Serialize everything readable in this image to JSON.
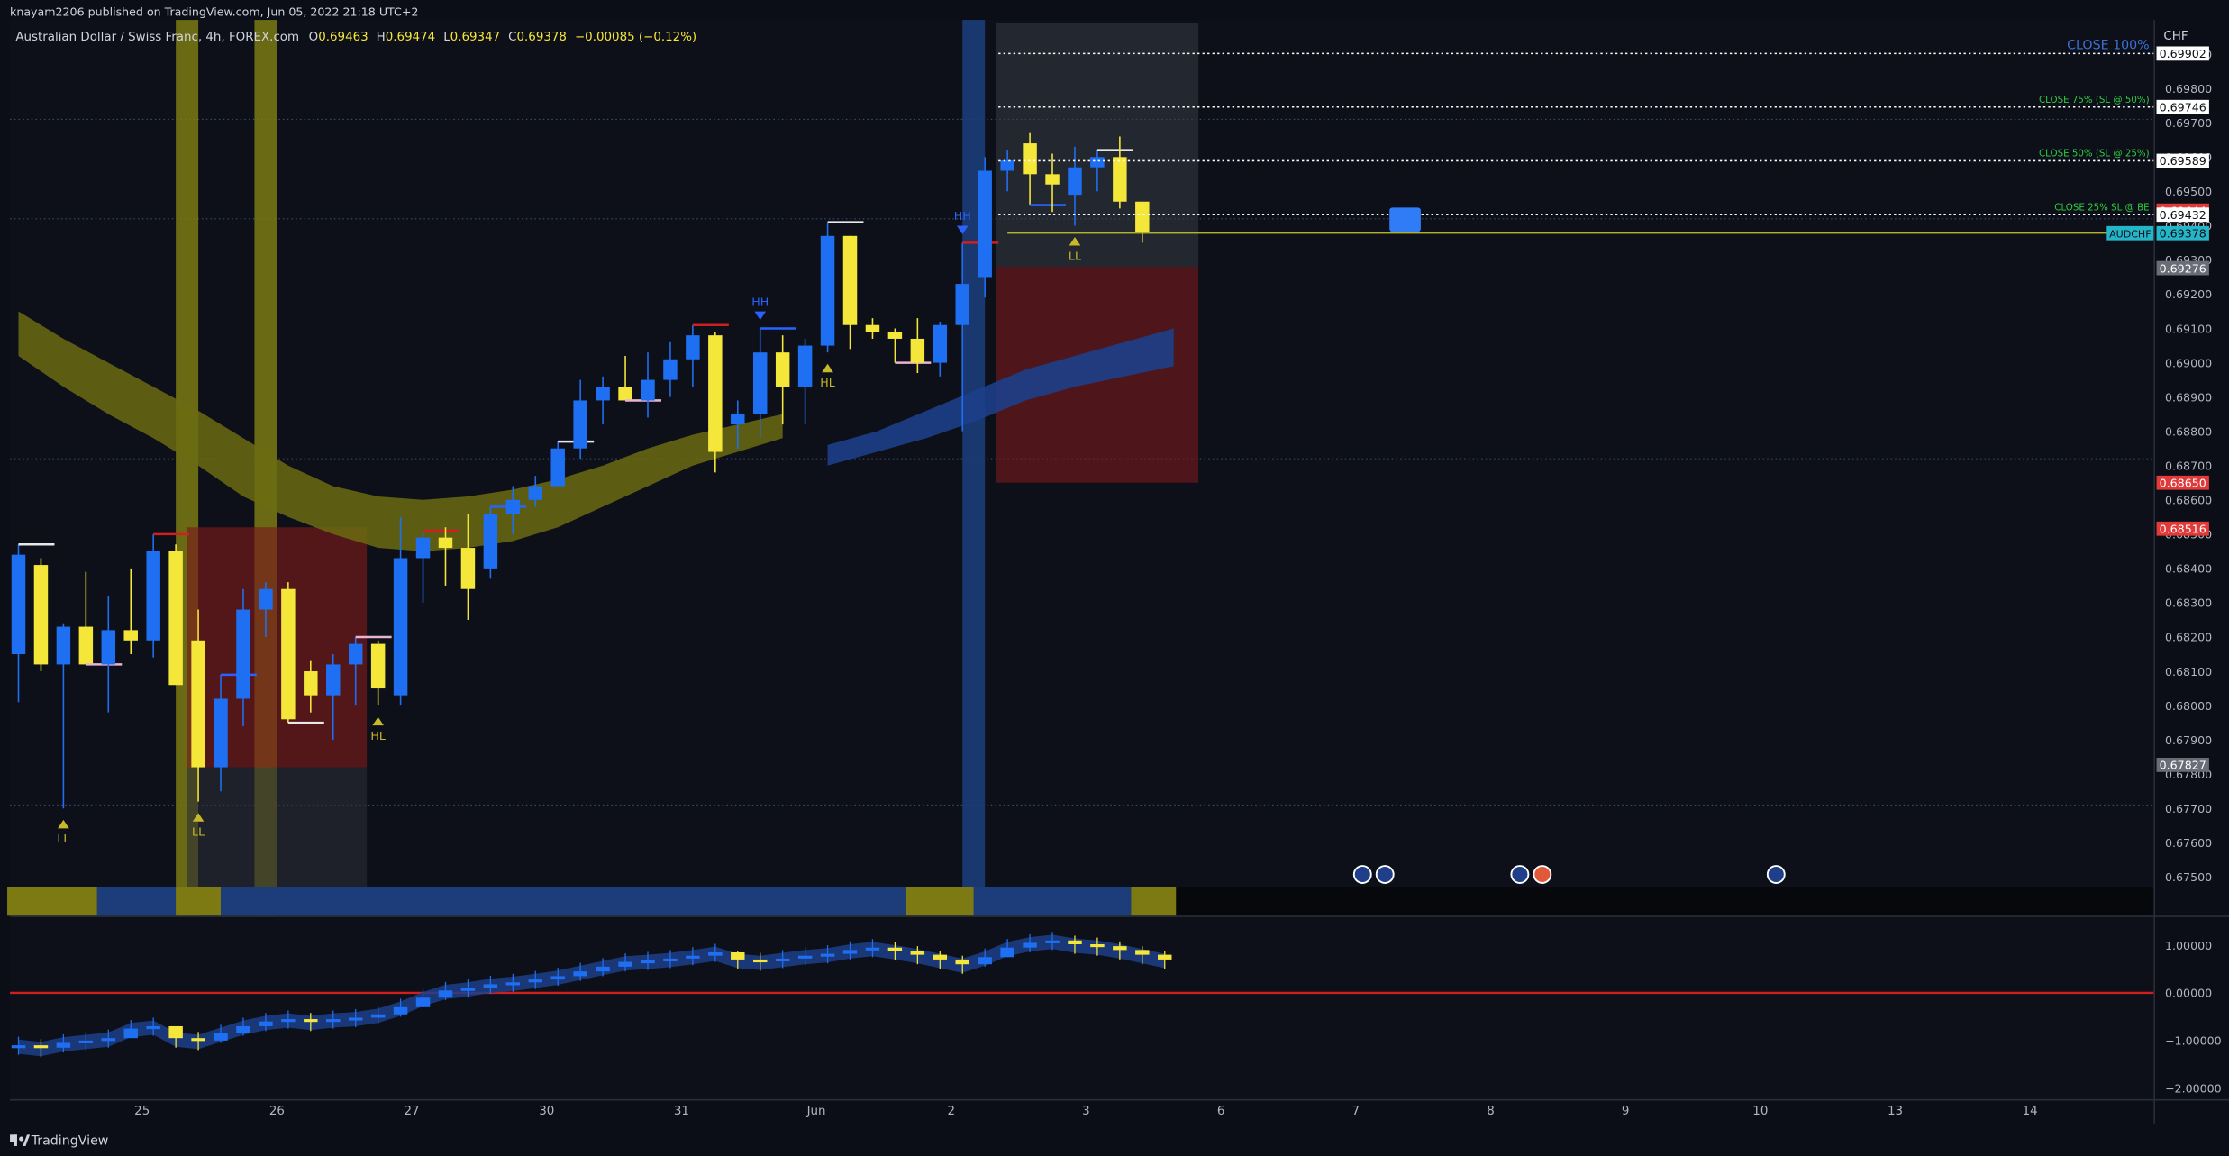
{
  "publisher": {
    "text": "knayam2206 published on TradingView.com, Jun 05, 2022 21:18 UTC+2"
  },
  "legend": {
    "symbol": "Australian Dollar / Swiss Franc, 4h, FOREX.com",
    "o_label": "O",
    "o": "0.69463",
    "h_label": "H",
    "h": "0.69474",
    "l_label": "L",
    "l": "0.69347",
    "c_label": "C",
    "c": "0.69378",
    "change": "−0.00085 (−0.12%)"
  },
  "currency": "CHF",
  "brand": "TradingView",
  "colors": {
    "bull": "#1f6ff2",
    "bear": "#f5e63a",
    "ema_band": "#6b6b12",
    "blue_band": "#1d3f8a",
    "highlight_yellow": "#7d7a14",
    "highlight_blue": "#1c3d7a",
    "red_zone": "#7a1a1a",
    "green_text": "#2ecc40",
    "price_tag_cyan": "#24b6c8",
    "price_tag_red": "#e03a3a",
    "zero_line": "#d01f1f"
  },
  "icons": {
    "brand": "tradingview-logo-icon",
    "events": "economic-event-flag-icon",
    "pivots_up": "triangle-up-icon",
    "pivots_down": "triangle-down-icon"
  },
  "trade_levels": [
    {
      "label": "CLOSE 100%",
      "value": 0.69902,
      "style": "blue"
    },
    {
      "label": "CLOSE 75% (SL @ 50%)",
      "value": 0.69746,
      "style": "green"
    },
    {
      "label": "CLOSE 50% (SL @ 25%)",
      "value": 0.69589,
      "style": "green"
    },
    {
      "label": "CLOSE 25% SL @ BE",
      "value": 0.69432,
      "style": "green"
    }
  ],
  "current_tag": {
    "symbol": "AUDCHF",
    "value": "0.69378"
  },
  "price_tags": [
    {
      "text": "0.69902",
      "value": 0.69902,
      "kind": "white"
    },
    {
      "text": "0.69746",
      "value": 0.69746,
      "kind": "white"
    },
    {
      "text": "0.69589",
      "value": 0.69589,
      "kind": "white"
    },
    {
      "text": "0.69444",
      "value": 0.69444,
      "kind": "red"
    },
    {
      "text": "0.69432",
      "value": 0.69432,
      "kind": "white"
    },
    {
      "text": "0.69378",
      "value": 0.69378,
      "kind": "cyan"
    },
    {
      "text": "0.69276",
      "value": 0.69276,
      "kind": "gray"
    },
    {
      "text": "0.68650",
      "value": 0.6865,
      "kind": "red"
    },
    {
      "text": "0.68516",
      "value": 0.68516,
      "kind": "red"
    },
    {
      "text": "0.67827",
      "value": 0.67827,
      "kind": "gray"
    }
  ],
  "pivot_labels": [
    {
      "text": "LL",
      "dir": "up",
      "x": 2
    },
    {
      "text": "LL",
      "dir": "up",
      "x": 8
    },
    {
      "text": "HL",
      "dir": "up",
      "x": 16
    },
    {
      "text": "HH",
      "dir": "down",
      "x": 33
    },
    {
      "text": "HL",
      "dir": "up",
      "x": 36
    },
    {
      "text": "HH",
      "dir": "down",
      "x": 42
    },
    {
      "text": "LL",
      "dir": "up",
      "x": 47
    }
  ],
  "chart_data": {
    "type": "candlestick",
    "y_axis_ticks": [
      "0.69900",
      "0.69800",
      "0.69700",
      "0.69600",
      "0.69500",
      "0.69400",
      "0.69300",
      "0.69200",
      "0.69100",
      "0.69000",
      "0.68900",
      "0.68800",
      "0.68700",
      "0.68600",
      "0.68500",
      "0.68400",
      "0.68300",
      "0.68200",
      "0.68100",
      "0.68000",
      "0.67900",
      "0.67800",
      "0.67700",
      "0.67600",
      "0.67500"
    ],
    "ylim": [
      0.6747,
      0.7
    ],
    "x_ticks": [
      {
        "label": "25",
        "x": 5.5
      },
      {
        "label": "26",
        "x": 11.5
      },
      {
        "label": "27",
        "x": 17.5
      },
      {
        "label": "30",
        "x": 23.5
      },
      {
        "label": "31",
        "x": 29.5
      },
      {
        "label": "Jun",
        "x": 35.5
      },
      {
        "label": "2",
        "x": 41.5
      },
      {
        "label": "3",
        "x": 47.5
      },
      {
        "label": "6",
        "x": 53.5
      },
      {
        "label": "7",
        "x": 59.5
      },
      {
        "label": "8",
        "x": 65.5
      },
      {
        "label": "9",
        "x": 71.5
      },
      {
        "label": "10",
        "x": 77.5
      },
      {
        "label": "13",
        "x": 83.5
      },
      {
        "label": "14",
        "x": 89.5
      }
    ],
    "x_range": [
      0,
      95
    ],
    "candles": [
      [
        0.6815,
        0.6847,
        0.6801,
        0.6844
      ],
      [
        0.6841,
        0.6843,
        0.681,
        0.6812
      ],
      [
        0.6812,
        0.6824,
        0.677,
        0.6823
      ],
      [
        0.6823,
        0.6839,
        0.6812,
        0.6812
      ],
      [
        0.6812,
        0.6832,
        0.6798,
        0.6822
      ],
      [
        0.6822,
        0.684,
        0.6815,
        0.6819
      ],
      [
        0.6819,
        0.685,
        0.6814,
        0.6845
      ],
      [
        0.6845,
        0.6847,
        0.681,
        0.6806
      ],
      [
        0.6819,
        0.6828,
        0.6772,
        0.6782
      ],
      [
        0.6782,
        0.6809,
        0.6775,
        0.6802
      ],
      [
        0.6802,
        0.6834,
        0.6794,
        0.6828
      ],
      [
        0.6828,
        0.6836,
        0.682,
        0.6834
      ],
      [
        0.6834,
        0.6836,
        0.6795,
        0.6796
      ],
      [
        0.681,
        0.6813,
        0.6798,
        0.6803
      ],
      [
        0.6803,
        0.6815,
        0.679,
        0.6812
      ],
      [
        0.6812,
        0.682,
        0.68,
        0.6818
      ],
      [
        0.6818,
        0.6819,
        0.68,
        0.6805
      ],
      [
        0.6803,
        0.6855,
        0.68,
        0.6843
      ],
      [
        0.6843,
        0.6851,
        0.683,
        0.6849
      ],
      [
        0.6849,
        0.6852,
        0.6835,
        0.6846
      ],
      [
        0.6846,
        0.6856,
        0.6825,
        0.6834
      ],
      [
        0.684,
        0.6858,
        0.6837,
        0.6856
      ],
      [
        0.6856,
        0.6864,
        0.685,
        0.686
      ],
      [
        0.686,
        0.6867,
        0.6858,
        0.6864
      ],
      [
        0.6864,
        0.6877,
        0.6864,
        0.6875
      ],
      [
        0.6875,
        0.6895,
        0.6872,
        0.6889
      ],
      [
        0.6889,
        0.6896,
        0.6882,
        0.6893
      ],
      [
        0.6893,
        0.6902,
        0.6889,
        0.6889
      ],
      [
        0.6889,
        0.6903,
        0.6884,
        0.6895
      ],
      [
        0.6895,
        0.6906,
        0.689,
        0.6901
      ],
      [
        0.6901,
        0.6911,
        0.6893,
        0.6908
      ],
      [
        0.6908,
        0.6909,
        0.6868,
        0.6874
      ],
      [
        0.6882,
        0.6889,
        0.6875,
        0.6885
      ],
      [
        0.6885,
        0.691,
        0.6878,
        0.6903
      ],
      [
        0.6903,
        0.6908,
        0.6882,
        0.6893
      ],
      [
        0.6893,
        0.6907,
        0.6882,
        0.6905
      ],
      [
        0.6905,
        0.6941,
        0.6903,
        0.6937
      ],
      [
        0.6937,
        0.6937,
        0.6904,
        0.6911
      ],
      [
        0.6911,
        0.6913,
        0.6907,
        0.6909
      ],
      [
        0.6909,
        0.691,
        0.69,
        0.6907
      ],
      [
        0.6907,
        0.6913,
        0.6897,
        0.69
      ],
      [
        0.69,
        0.6912,
        0.6896,
        0.6911
      ],
      [
        0.6911,
        0.6935,
        0.688,
        0.6923
      ],
      [
        0.6925,
        0.696,
        0.6919,
        0.6956
      ],
      [
        0.6956,
        0.6962,
        0.695,
        0.6959
      ],
      [
        0.6964,
        0.6967,
        0.6946,
        0.6955
      ],
      [
        0.6955,
        0.6961,
        0.6944,
        0.6952
      ],
      [
        0.6949,
        0.6963,
        0.694,
        0.6957
      ],
      [
        0.6957,
        0.6962,
        0.695,
        0.696
      ],
      [
        0.696,
        0.6966,
        0.6945,
        0.6947
      ],
      [
        0.6947,
        0.6947,
        0.6935,
        0.6938
      ]
    ]
  },
  "oscillator": {
    "y_axis_ticks": [
      "1.00000",
      "0.00000",
      "−1.00000",
      "−2.00000"
    ],
    "ylim": [
      -2.2,
      1.5
    ],
    "values": [
      -1.1,
      -1.15,
      -1.05,
      -1.0,
      -0.95,
      -0.75,
      -0.7,
      -0.95,
      -1.0,
      -0.85,
      -0.7,
      -0.6,
      -0.55,
      -0.6,
      -0.55,
      -0.52,
      -0.45,
      -0.3,
      -0.1,
      0.05,
      0.1,
      0.18,
      0.22,
      0.28,
      0.35,
      0.45,
      0.55,
      0.65,
      0.68,
      0.72,
      0.78,
      0.85,
      0.7,
      0.66,
      0.72,
      0.78,
      0.82,
      0.9,
      0.95,
      0.88,
      0.8,
      0.7,
      0.6,
      0.75,
      0.95,
      1.05,
      1.1,
      1.02,
      0.98,
      0.9,
      0.8,
      0.7
    ]
  }
}
